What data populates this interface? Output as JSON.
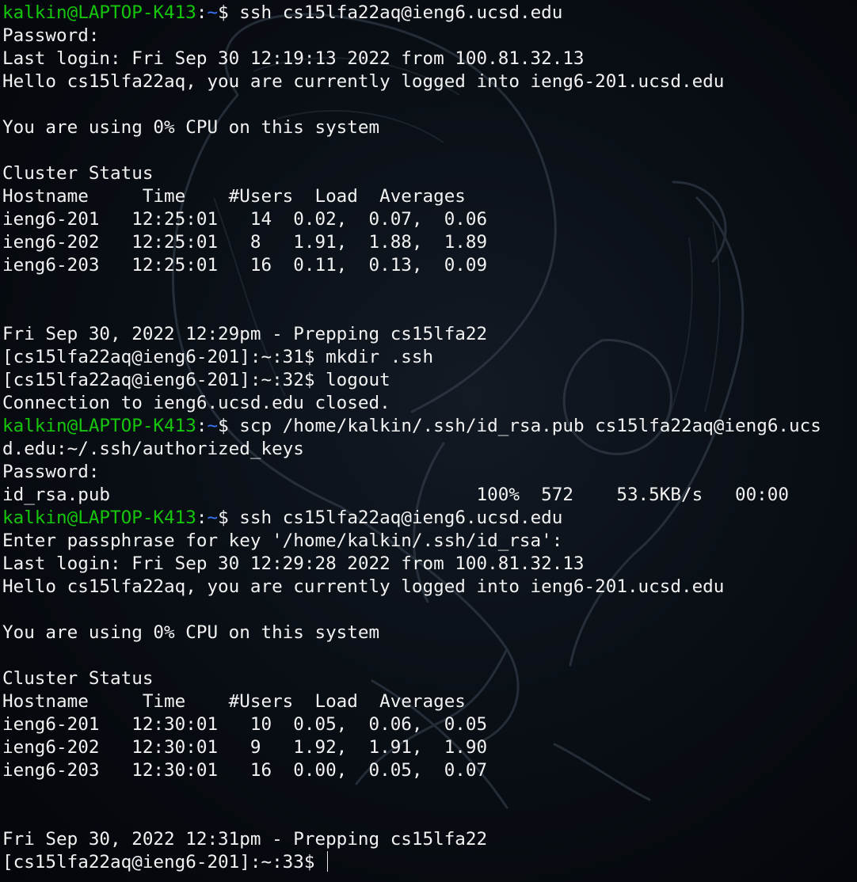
{
  "colors": {
    "background": "#05080d",
    "text": "#f2f2f2",
    "prompt_user": "#16c60c",
    "prompt_path": "#3b78ff"
  },
  "icons": [
    "background-illustration"
  ],
  "lines": [
    {
      "kind": "prompt",
      "user": "kalkin@LAPTOP-K413",
      "path": "~",
      "command": "ssh cs15lfa22aq@ieng6.ucsd.edu"
    },
    {
      "kind": "text",
      "text": "Password:"
    },
    {
      "kind": "text",
      "text": "Last login: Fri Sep 30 12:19:13 2022 from 100.81.32.13"
    },
    {
      "kind": "text",
      "text": "Hello cs15lfa22aq, you are currently logged into ieng6-201.ucsd.edu"
    },
    {
      "kind": "text",
      "text": ""
    },
    {
      "kind": "text",
      "text": "You are using 0% CPU on this system"
    },
    {
      "kind": "text",
      "text": ""
    },
    {
      "kind": "text",
      "text": "Cluster Status"
    },
    {
      "kind": "text",
      "text": "Hostname     Time    #Users  Load  Averages"
    },
    {
      "kind": "text",
      "text": "ieng6-201   12:25:01   14  0.02,  0.07,  0.06"
    },
    {
      "kind": "text",
      "text": "ieng6-202   12:25:01   8   1.91,  1.88,  1.89"
    },
    {
      "kind": "text",
      "text": "ieng6-203   12:25:01   16  0.11,  0.13,  0.09"
    },
    {
      "kind": "text",
      "text": ""
    },
    {
      "kind": "text",
      "text": ""
    },
    {
      "kind": "text",
      "text": "Fri Sep 30, 2022 12:29pm - Prepping cs15lfa22"
    },
    {
      "kind": "text",
      "text": "[cs15lfa22aq@ieng6-201]:~:31$ mkdir .ssh"
    },
    {
      "kind": "text",
      "text": "[cs15lfa22aq@ieng6-201]:~:32$ logout"
    },
    {
      "kind": "text",
      "text": "Connection to ieng6.ucsd.edu closed."
    },
    {
      "kind": "prompt",
      "user": "kalkin@LAPTOP-K413",
      "path": "~",
      "command": "scp /home/kalkin/.ssh/id_rsa.pub cs15lfa22aq@ieng6.ucs"
    },
    {
      "kind": "text",
      "text": "d.edu:~/.ssh/authorized_keys"
    },
    {
      "kind": "text",
      "text": "Password:"
    },
    {
      "kind": "text",
      "text": "id_rsa.pub                                  100%  572    53.5KB/s   00:00"
    },
    {
      "kind": "prompt",
      "user": "kalkin@LAPTOP-K413",
      "path": "~",
      "command": "ssh cs15lfa22aq@ieng6.ucsd.edu"
    },
    {
      "kind": "text",
      "text": "Enter passphrase for key '/home/kalkin/.ssh/id_rsa':"
    },
    {
      "kind": "text",
      "text": "Last login: Fri Sep 30 12:29:28 2022 from 100.81.32.13"
    },
    {
      "kind": "text",
      "text": "Hello cs15lfa22aq, you are currently logged into ieng6-201.ucsd.edu"
    },
    {
      "kind": "text",
      "text": ""
    },
    {
      "kind": "text",
      "text": "You are using 0% CPU on this system"
    },
    {
      "kind": "text",
      "text": ""
    },
    {
      "kind": "text",
      "text": "Cluster Status"
    },
    {
      "kind": "text",
      "text": "Hostname     Time    #Users  Load  Averages"
    },
    {
      "kind": "text",
      "text": "ieng6-201   12:30:01   10  0.05,  0.06,  0.05"
    },
    {
      "kind": "text",
      "text": "ieng6-202   12:30:01   9   1.92,  1.91,  1.90"
    },
    {
      "kind": "text",
      "text": "ieng6-203   12:30:01   16  0.00,  0.05,  0.07"
    },
    {
      "kind": "text",
      "text": ""
    },
    {
      "kind": "text",
      "text": ""
    },
    {
      "kind": "text",
      "text": "Fri Sep 30, 2022 12:31pm - Prepping cs15lfa22"
    },
    {
      "kind": "input",
      "text": "[cs15lfa22aq@ieng6-201]:~:33$ "
    }
  ]
}
